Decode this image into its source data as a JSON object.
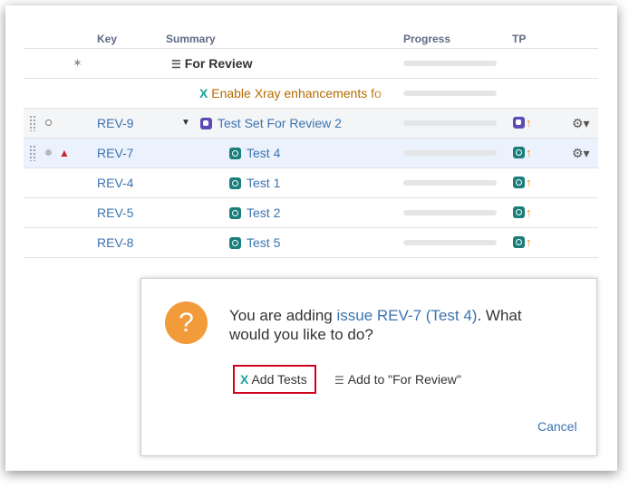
{
  "table": {
    "headers": {
      "key": "Key",
      "summary": "Summary",
      "progress": "Progress",
      "tp": "TP"
    },
    "group_title": "For Review",
    "xray_notice": "Enable Xray enhancements fo",
    "rows": [
      {
        "key": "REV-9",
        "summary": "Test Set For Review 2",
        "type": "test-set"
      },
      {
        "key": "REV-7",
        "summary": "Test 4",
        "type": "test"
      },
      {
        "key": "REV-4",
        "summary": "Test 1",
        "type": "test"
      },
      {
        "key": "REV-5",
        "summary": "Test 2",
        "type": "test"
      },
      {
        "key": "REV-8",
        "summary": "Test 5",
        "type": "test"
      }
    ]
  },
  "dialog": {
    "message_prefix": "You are adding",
    "issue_link": "issue REV-7 (Test 4)",
    "message_suffix": ". What would you like to do?",
    "add_tests_label": "Add Tests",
    "add_to_label": "Add to \"For Review\"",
    "cancel_label": "Cancel"
  },
  "colors": {
    "accent_link": "#3b73af",
    "highlight_border": "#d0021b",
    "question": "#f29b3b",
    "xray": "#1ba39c"
  }
}
